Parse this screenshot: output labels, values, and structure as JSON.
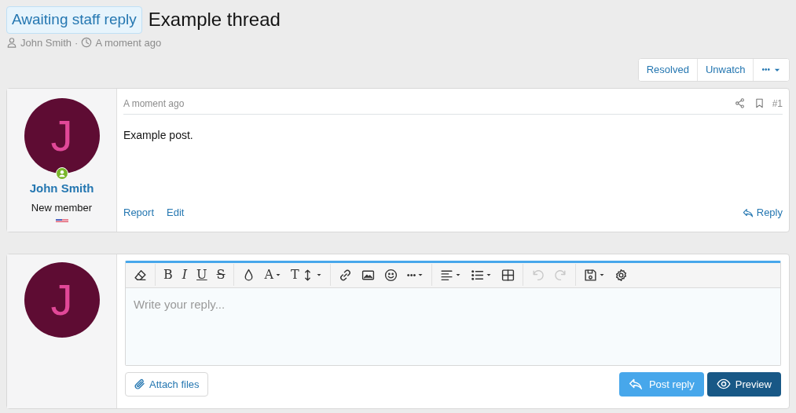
{
  "thread": {
    "prefix": "Awaiting staff reply",
    "title": "Example thread",
    "author": "John Smith",
    "separator": "·",
    "time": "A moment ago"
  },
  "thread_actions": [
    {
      "label": "Resolved",
      "kind": "text"
    },
    {
      "label": "Unwatch",
      "kind": "text"
    },
    {
      "label": "•••",
      "kind": "menu"
    }
  ],
  "post": {
    "avatar_letter": "J",
    "online": true,
    "username": "John Smith",
    "user_title": "New member",
    "time": "A moment ago",
    "number": "#1",
    "body": "Example post.",
    "actions": [
      "Report",
      "Edit"
    ],
    "reply": "Reply"
  },
  "reply_form": {
    "avatar_letter": "J",
    "placeholder": "Write your reply...",
    "toolbar": [
      [
        {
          "menu": false,
          "disabled": false
        }
      ],
      [
        {
          "label": "B",
          "menu": false,
          "disabled": false
        },
        {
          "label": "I",
          "menu": false,
          "disabled": false
        },
        {
          "label": "U",
          "menu": false,
          "disabled": false
        },
        {
          "label": "S",
          "menu": false,
          "disabled": false
        }
      ],
      [
        {
          "menu": false,
          "disabled": false
        },
        {
          "label": "A",
          "menu": true,
          "disabled": false
        },
        {
          "label": "T",
          "menu": true,
          "disabled": false
        }
      ],
      [
        {
          "menu": false,
          "disabled": false
        },
        {
          "menu": false,
          "disabled": false
        },
        {
          "menu": false,
          "disabled": false
        },
        {
          "label": "•••",
          "menu": true,
          "disabled": false
        }
      ],
      [
        {
          "menu": true,
          "disabled": false
        },
        {
          "menu": true,
          "disabled": false
        },
        {
          "menu": false,
          "disabled": false
        }
      ],
      [
        {
          "menu": false,
          "disabled": true
        },
        {
          "menu": false,
          "disabled": true
        }
      ],
      [
        {
          "menu": true,
          "disabled": false
        },
        {
          "menu": false,
          "disabled": false
        }
      ]
    ],
    "attach": "Attach files",
    "post_button": "Post reply",
    "preview_button": "Preview"
  }
}
